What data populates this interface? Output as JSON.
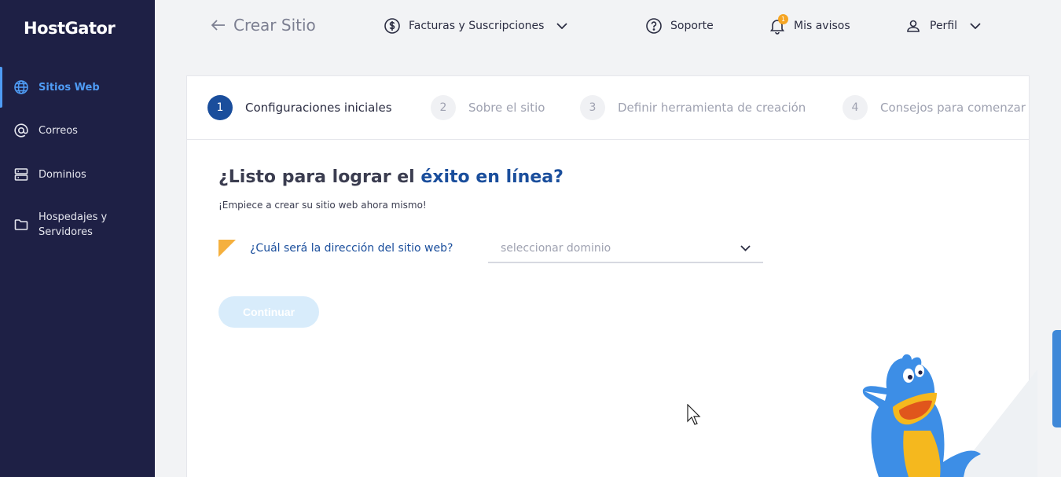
{
  "brand": {
    "logo_text": "HostGator"
  },
  "sidebar": {
    "items": [
      {
        "label": "Sitios Web",
        "icon": "globe-icon",
        "active": true
      },
      {
        "label": "Correos",
        "icon": "at-icon",
        "active": false
      },
      {
        "label": "Dominios",
        "icon": "server-icon",
        "active": false
      },
      {
        "label": "Hospedajes y Servidores",
        "icon": "folder-icon",
        "active": false
      }
    ]
  },
  "header": {
    "back_label": "Crear Sitio",
    "billing_label": "Facturas y Suscripciones",
    "support_label": "Soporte",
    "notices_label": "Mis avisos",
    "notices_count": "1",
    "profile_label": "Perfil"
  },
  "steps": [
    {
      "num": "1",
      "label": "Configuraciones iniciales",
      "active": true
    },
    {
      "num": "2",
      "label": "Sobre el sitio",
      "active": false
    },
    {
      "num": "3",
      "label": "Definir herramienta de creación",
      "active": false
    },
    {
      "num": "4",
      "label": "Consejos para comenzar",
      "active": false
    }
  ],
  "main": {
    "title_prefix": "¿Listo para lograr el ",
    "title_highlight": "éxito en línea?",
    "subtitle": "¡Empiece a crear su sitio web ahora mismo!",
    "question": "¿Cuál será la dirección del sitio web?",
    "select_placeholder": "seleccionar dominio",
    "continue_label": "Continuar"
  },
  "colors": {
    "sidebar_bg": "#1e2045",
    "accent": "#4f9cf5",
    "primary": "#1a4e9c",
    "warning": "#f5b03e",
    "button_disabled": "#d8ecfb"
  }
}
